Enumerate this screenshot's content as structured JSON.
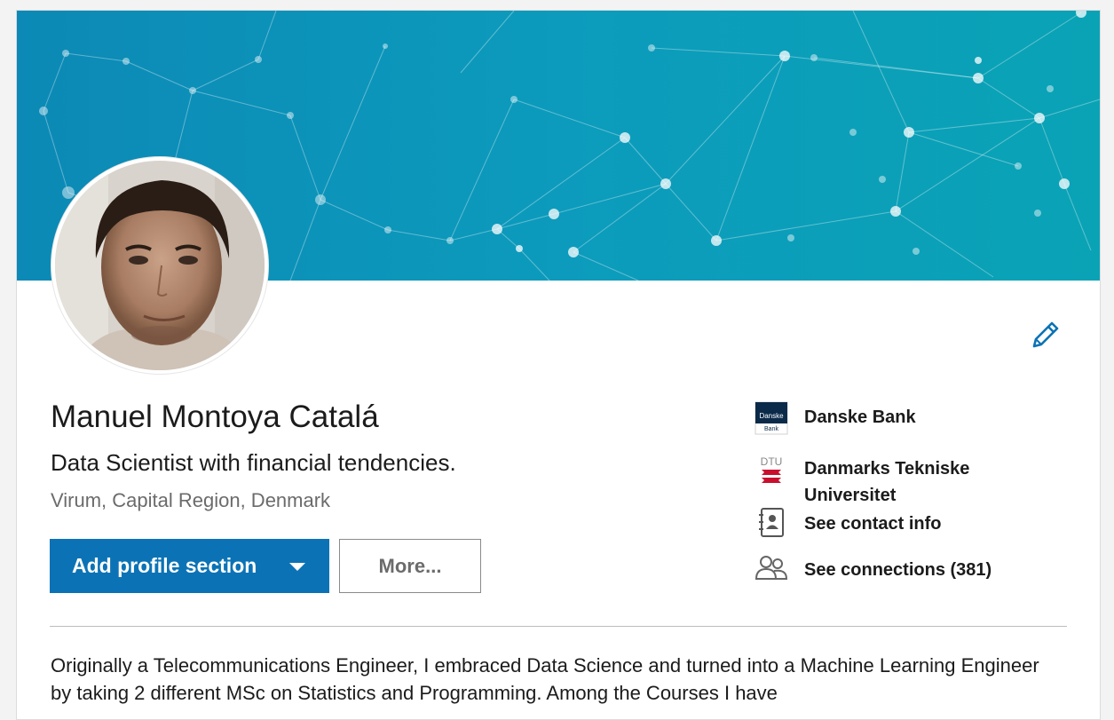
{
  "profile": {
    "name": "Manuel Montoya Catalá",
    "headline": "Data Scientist with financial tendencies.",
    "location": "Virum, Capital Region, Denmark"
  },
  "actions": {
    "add_section_label": "Add profile section",
    "more_label": "More..."
  },
  "sidebar": {
    "company": "Danske Bank",
    "company_logo_text_1": "Danske",
    "company_logo_text_2": "Bank",
    "school": "Danmarks Tekniske Universitet",
    "school_logo_text": "DTU",
    "contact": "See contact info",
    "connections": "See connections (381)"
  },
  "summary": {
    "text": "Originally a Telecommunications Engineer, I embraced Data Science and turned into a Machine Learning Engineer by taking 2 different MSc on Statistics and Programming. Among the Courses I have"
  },
  "icons": {
    "edit": "pencil-icon",
    "contact": "contact-book-icon",
    "connections": "people-icon"
  },
  "colors": {
    "primary_button": "#0b73b5",
    "banner": "#0c9bbc",
    "dtu_red": "#c8102e"
  }
}
